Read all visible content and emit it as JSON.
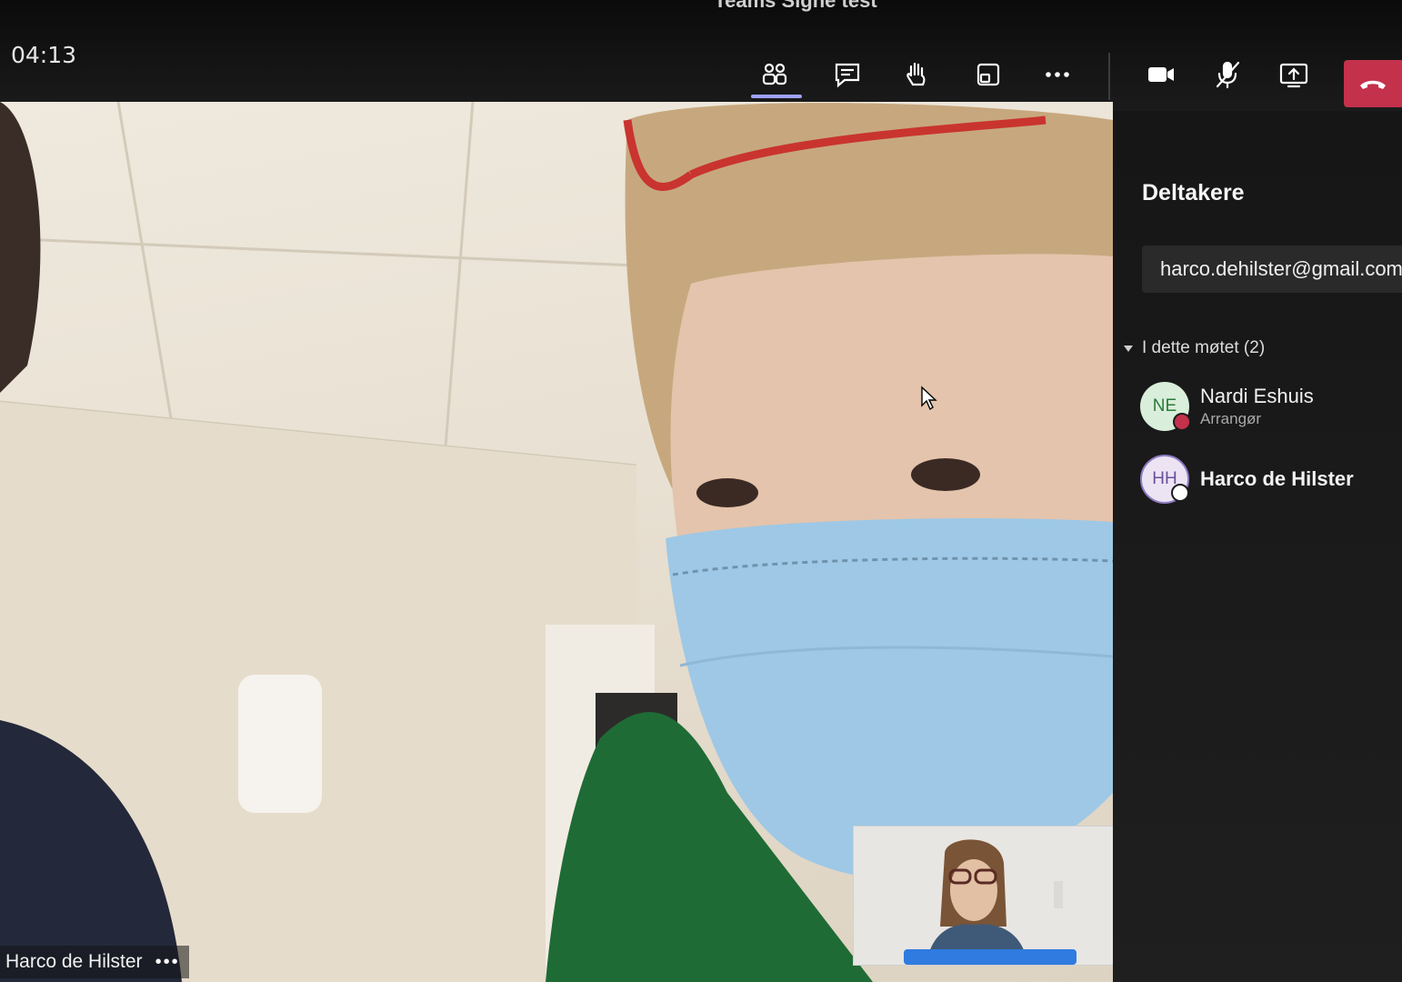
{
  "window": {
    "title": "Teams Signe test"
  },
  "meeting": {
    "timer": "04:13"
  },
  "toolbar": {
    "participants": "participants-icon",
    "chat": "chat-icon",
    "raise_hand": "raise-hand-icon",
    "rooms": "breakout-rooms-icon",
    "more": "more-actions-icon",
    "camera": "camera-icon",
    "mic": "mic-muted-icon",
    "share": "share-screen-icon",
    "leave": "hang-up-icon",
    "leave_color": "#c4314b",
    "accent_color": "#9ea2ff"
  },
  "stage": {
    "speaker_name": "Harco de Hilster",
    "more_label": "•••"
  },
  "panel": {
    "title": "Deltakere",
    "invite_value": "harco.dehilster@gmail.com",
    "section_label": "I dette møtet (2)",
    "participants": [
      {
        "initials": "NE",
        "name": "Nardi Eshuis",
        "role": "Arrangør",
        "presence_color": "#c4314b"
      },
      {
        "initials": "HH",
        "name": "Harco de Hilster",
        "role": "",
        "presence_color": "#ffffff"
      }
    ]
  }
}
